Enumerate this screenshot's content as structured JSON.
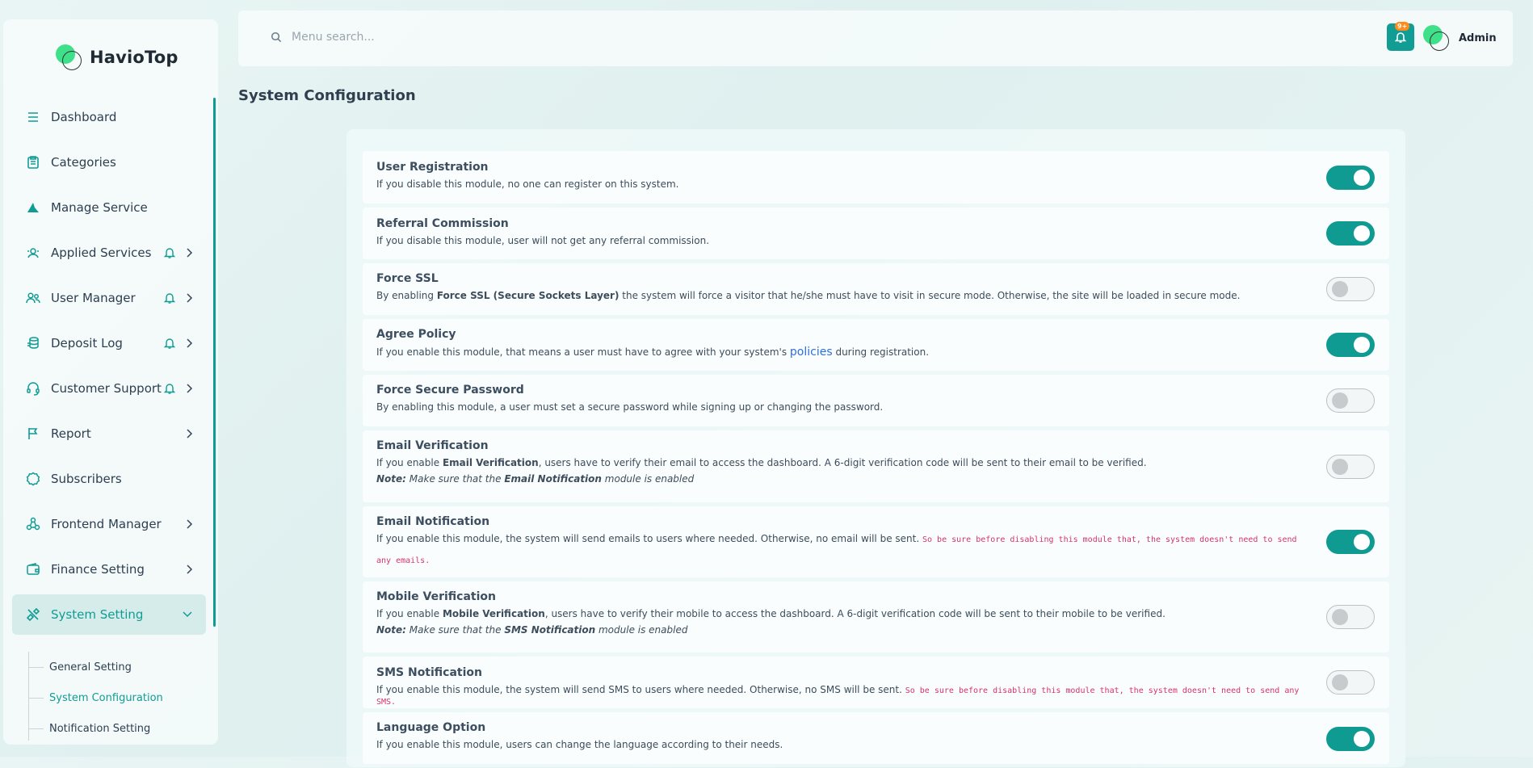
{
  "brand": {
    "name": "HavioTop"
  },
  "sidebar": {
    "items": [
      {
        "label": "Dashboard",
        "icon": "dashboard-icon"
      },
      {
        "label": "Categories",
        "icon": "clipboard-icon"
      },
      {
        "label": "Manage Service",
        "icon": "service-icon"
      },
      {
        "label": "Applied Services",
        "icon": "applied-services-icon"
      },
      {
        "label": "User Manager",
        "icon": "users-icon"
      },
      {
        "label": "Deposit Log",
        "icon": "coins-icon"
      },
      {
        "label": "Customer Support",
        "icon": "headset-icon"
      },
      {
        "label": "Report",
        "icon": "flag-icon"
      },
      {
        "label": "Subscribers",
        "icon": "badge-icon"
      },
      {
        "label": "Frontend Manager",
        "icon": "nodes-icon"
      },
      {
        "label": "Finance Setting",
        "icon": "wallet-icon"
      },
      {
        "label": "System Setting",
        "icon": "tools-icon"
      }
    ],
    "subitems": [
      {
        "label": "General Setting"
      },
      {
        "label": "System Configuration"
      },
      {
        "label": "Notification Setting"
      }
    ]
  },
  "topbar": {
    "search_placeholder": "Menu search...",
    "notification_badge": "9+",
    "user_name": "Admin"
  },
  "page": {
    "title": "System Configuration"
  },
  "colors": {
    "accent": "#0f9a92",
    "link": "#2f6fd8",
    "code": "#d6336c",
    "badge": "#ff8c1a"
  },
  "config": {
    "items": [
      {
        "title": "User Registration",
        "d1": "If you disable this module, no one can register on this system.",
        "enabled": true
      },
      {
        "title": "Referral Commission",
        "d1": "If you disable this module, user will not get any referral commission.",
        "enabled": true
      },
      {
        "title": "Force SSL",
        "d1": "By enabling ",
        "b1": "Force SSL (Secure Sockets Layer)",
        "d2": " the system will force a visitor that he/she must have to visit in secure mode. Otherwise, the site will be loaded in secure mode.",
        "enabled": false
      },
      {
        "title": "Agree Policy",
        "d1": "If you enable this module, that means a user must have to agree with your system's ",
        "link": "policies",
        "d2": " during registration.",
        "enabled": true
      },
      {
        "title": "Force Secure Password",
        "d1": "By enabling this module, a user must set a secure password while signing up or changing the password.",
        "enabled": false
      },
      {
        "title": "Email Verification",
        "d1": "If you enable ",
        "b1": "Email Verification",
        "d2": ", users have to verify their email to access the dashboard. A 6-digit verification code will be sent to their email to be verified.",
        "note_label": "Note:",
        "note_pre": " Make sure that the ",
        "note_bold": "Email Notification",
        "note_post": " module is enabled",
        "enabled": false
      },
      {
        "title": "Email Notification",
        "d1": "If you enable this module, the system will send emails to users where needed. Otherwise, no email will be sent. ",
        "code": "So be sure before disabling this module that, the system doesn't need to send any emails.",
        "enabled": true
      },
      {
        "title": "Mobile Verification",
        "d1": "If you enable ",
        "b1": "Mobile Verification",
        "d2": ", users have to verify their mobile to access the dashboard. A 6-digit verification code will be sent to their mobile to be verified.",
        "note_label": "Note:",
        "note_pre": " Make sure that the ",
        "note_bold": "SMS Notification",
        "note_post": " module is enabled",
        "enabled": false
      },
      {
        "title": "SMS Notification",
        "d1": "If you enable this module, the system will send SMS to users where needed. Otherwise, no SMS will be sent. ",
        "code": "So be sure before disabling this module that, the system doesn't need to send any SMS.",
        "enabled": false
      },
      {
        "title": "Language Option",
        "d1": "If you enable this module, users can change the language according to their needs.",
        "enabled": true
      }
    ]
  }
}
